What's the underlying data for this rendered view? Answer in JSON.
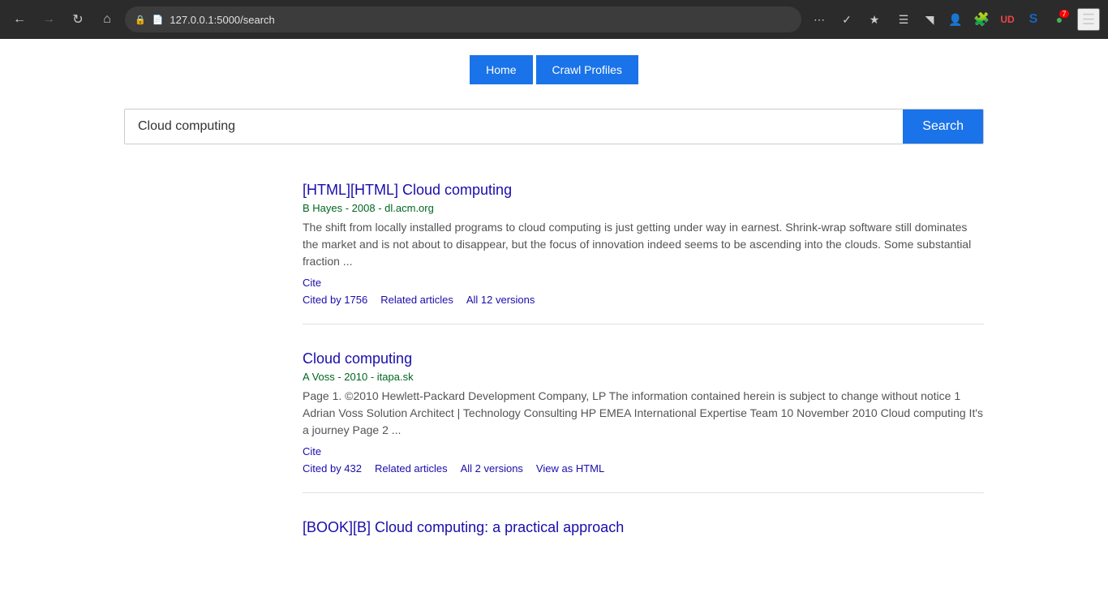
{
  "browser": {
    "address": "127.0.0.1:5000/search",
    "back_disabled": false,
    "forward_disabled": false
  },
  "nav": {
    "home_label": "Home",
    "crawl_profiles_label": "Crawl Profiles"
  },
  "search": {
    "input_value": "Cloud computing",
    "button_label": "Search"
  },
  "results": [
    {
      "id": 1,
      "title": "[HTML][HTML] Cloud computing",
      "meta": "B Hayes - 2008 - dl.acm.org",
      "snippet": "The shift from locally installed programs to cloud computing is just getting under way in earnest. Shrink-wrap software still dominates the market and is not about to disappear, but the focus of innovation indeed seems to be ascending into the clouds. Some substantial fraction ...",
      "cite": "Cite",
      "cited_by": "Cited by 1756",
      "related": "Related articles",
      "versions": "All 12 versions",
      "view_as_html": null
    },
    {
      "id": 2,
      "title": "Cloud computing",
      "meta": "A Voss - 2010 - itapa.sk",
      "snippet": "Page 1. ©2010 Hewlett-Packard Development Company, LP The information contained herein is subject to change without notice 1 Adrian Voss Solution Architect | Technology Consulting HP EMEA International Expertise Team 10 November 2010 Cloud computing It's a journey Page 2 ...",
      "cite": "Cite",
      "cited_by": "Cited by 432",
      "related": "Related articles",
      "versions": "All 2 versions",
      "view_as_html": "View as HTML"
    },
    {
      "id": 3,
      "title": "[BOOK][B] Cloud computing: a practical approach",
      "meta": "",
      "snippet": "",
      "cite": null,
      "cited_by": null,
      "related": null,
      "versions": null,
      "view_as_html": null
    }
  ]
}
